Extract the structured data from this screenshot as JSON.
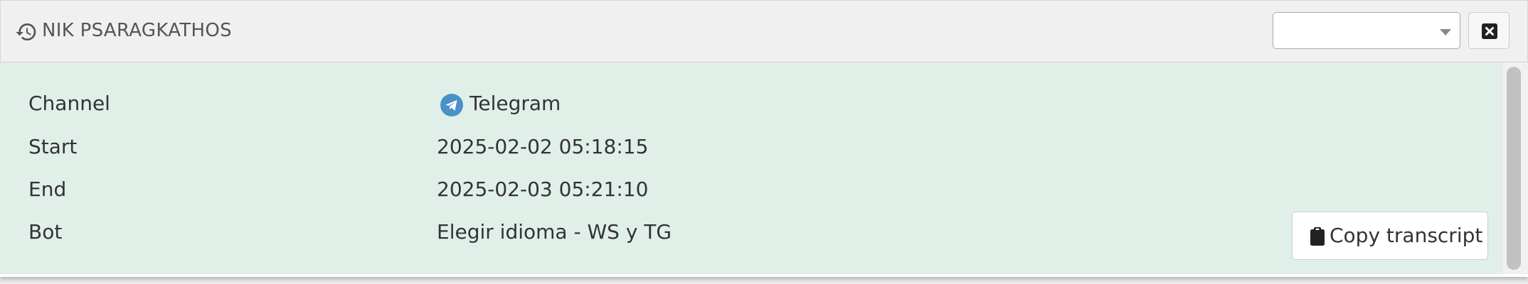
{
  "header": {
    "title": "NIK PSARAGKATHOS",
    "history_icon": "history-icon",
    "select": {
      "value": ""
    },
    "close_icon": "close-square-icon"
  },
  "details": {
    "rows": [
      {
        "label": "Channel",
        "value": "Telegram",
        "icon": "telegram-icon"
      },
      {
        "label": "Start",
        "value": "2025-02-02 05:18:15"
      },
      {
        "label": "End",
        "value": "2025-02-03 05:21:10"
      },
      {
        "label": "Bot",
        "value": "Elegir idioma - WS y TG"
      }
    ]
  },
  "actions": {
    "copy_label": "Copy transcript",
    "copy_icon": "clipboard-icon"
  },
  "colors": {
    "header_bg": "#f0f0f0",
    "body_bg": "#e1efe9",
    "telegram_blue": "#4a90c9",
    "text": "#333333"
  }
}
